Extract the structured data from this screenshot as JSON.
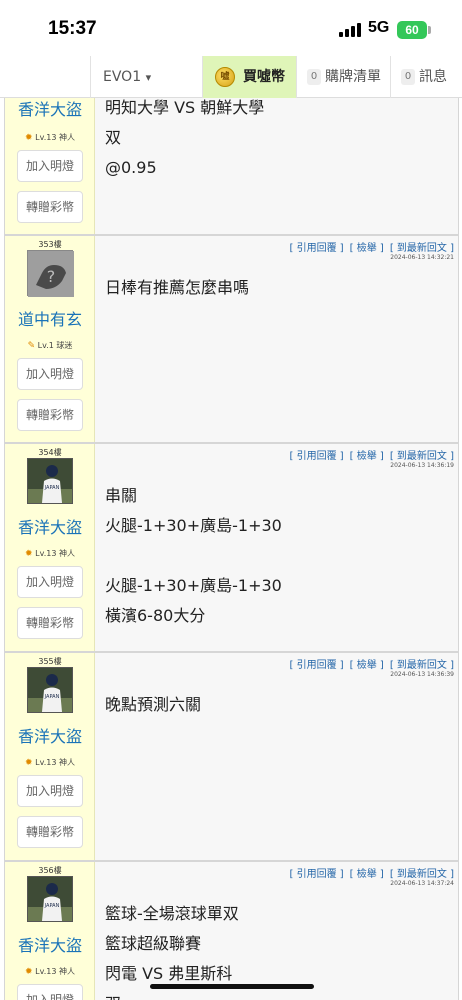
{
  "status_bar": {
    "time": "15:37",
    "network": "5G",
    "battery": "60"
  },
  "nav": {
    "user": "EVO1",
    "user_caret": "▾",
    "buy_label": "買噓幣",
    "coin_glyph": "噓",
    "list_count": "0",
    "list_label": "購牌清單",
    "msg_count": "0",
    "msg_label": "訊息"
  },
  "actions": {
    "quote": "[ 引用回覆 ]",
    "report": "[ 檢舉 ]",
    "latest": "[ 到最新回文 ]"
  },
  "side_buttons": {
    "light": "加入明燈",
    "gift": "轉贈彩幣"
  },
  "posts": [
    {
      "user": "香洋大盜",
      "level": "Lv.13 神人",
      "lines": [
        "明知大學 VS 朝鮮大學",
        "双",
        "@0.95"
      ]
    },
    {
      "floor": "353樓",
      "user": "道中有玄",
      "level": "Lv.1 球迷",
      "timestamp": "2024-06-13 14:32:21",
      "lines": [
        "日棒有推薦怎麼串嗎"
      ]
    },
    {
      "floor": "354樓",
      "user": "香洋大盜",
      "level": "Lv.13 神人",
      "timestamp": "2024-06-13 14:36:19",
      "lines": [
        "串關",
        "火腿-1+30+廣島-1+30",
        "",
        "火腿-1+30+廣島-1+30",
        "橫濱6-80大分"
      ]
    },
    {
      "floor": "355樓",
      "user": "香洋大盜",
      "level": "Lv.13 神人",
      "timestamp": "2024-06-13 14:36:39",
      "lines": [
        "晚點預測六關"
      ]
    },
    {
      "floor": "356樓",
      "user": "香洋大盜",
      "level": "Lv.13 神人",
      "timestamp": "2024-06-13 14:37:24",
      "lines": [
        "籃球-全場滾球單双",
        "籃球超級聯賽",
        "閃電 VS 弗里斯科",
        "双"
      ]
    }
  ]
}
